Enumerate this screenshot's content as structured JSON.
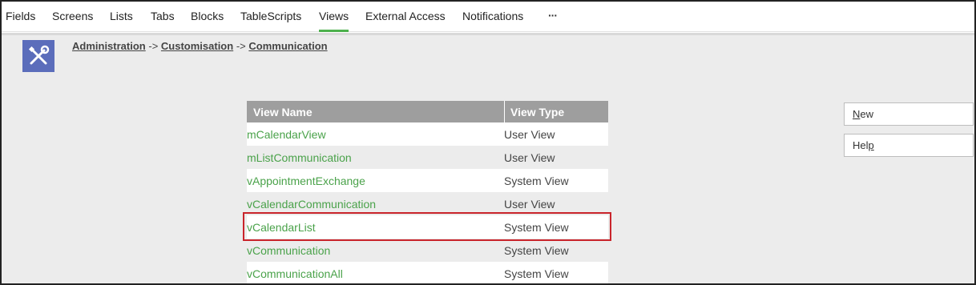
{
  "nav": {
    "tabs": [
      "Fields",
      "Screens",
      "Lists",
      "Tabs",
      "Blocks",
      "TableScripts",
      "Views",
      "External Access",
      "Notifications"
    ],
    "active_tab": "Views",
    "more_label": "···"
  },
  "breadcrumb": {
    "items": [
      "Administration",
      "Customisation",
      "Communication"
    ],
    "separator": "->"
  },
  "table": {
    "headers": [
      "View Name",
      "View Type"
    ],
    "rows": [
      {
        "name": "mCalendarView",
        "type": "User View"
      },
      {
        "name": "mListCommunication",
        "type": "User View"
      },
      {
        "name": "vAppointmentExchange",
        "type": "System View"
      },
      {
        "name": "vCalendarCommunication",
        "type": "User View"
      },
      {
        "name": "vCalendarList",
        "type": "System View"
      },
      {
        "name": "vCommunication",
        "type": "System View"
      },
      {
        "name": "vCommunicationAll",
        "type": "System View"
      }
    ],
    "highlighted_row": "vCalendarList"
  },
  "actions": {
    "new_first": "N",
    "new_rest": "ew",
    "help_pre": "Hel",
    "help_u": "p"
  },
  "colors": {
    "accent": "#4db14d",
    "link": "#4aa24a",
    "header_bg": "#9e9e9e",
    "icon_bg": "#5b6dbb",
    "highlight": "#c9242b"
  },
  "icons": {
    "admin": "tools-icon"
  }
}
